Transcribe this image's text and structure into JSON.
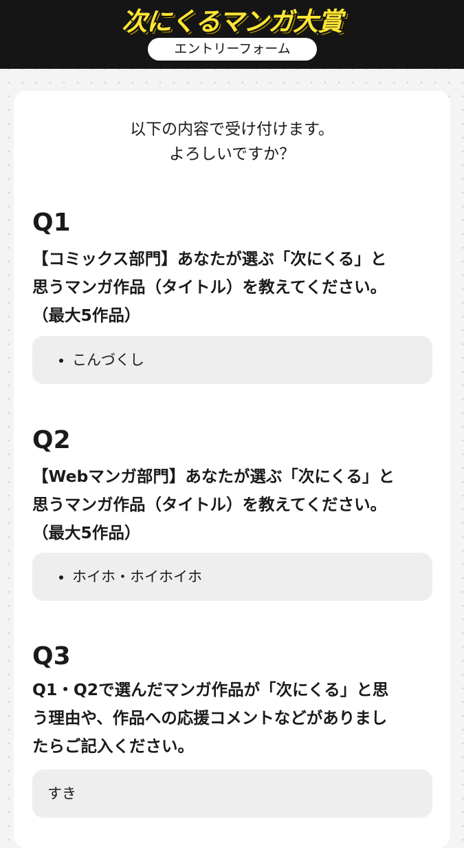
{
  "header": {
    "logo_text": "次にくるマンガ大賞",
    "form_label": "エントリーフォーム"
  },
  "intro": {
    "line1": "以下の内容で受け付けます。",
    "line2": "よろしいですか？"
  },
  "questions": [
    {
      "number": "Q1",
      "text_lines": [
        "【コミックス部門】あなたが選ぶ「次にくる」と",
        "思うマンガ作品（タイトル）を教えてください。",
        "（最大5作品）"
      ],
      "answers": [
        "こんづくし"
      ]
    },
    {
      "number": "Q2",
      "text_lines": [
        "【Webマンガ部門】あなたが選ぶ「次にくる」と",
        "思うマンガ作品（タイトル）を教えてください。",
        "（最大5作品）"
      ],
      "answers": [
        "ホイホ・ホイホイホ"
      ]
    },
    {
      "number": "Q3",
      "text_lines": [
        "Q1・Q2で選んだマンガ作品が「次にくる」と思",
        "う理由や、作品への応援コメントなどがありまし",
        "たらご記入ください。"
      ],
      "answer_text": "すき"
    }
  ]
}
